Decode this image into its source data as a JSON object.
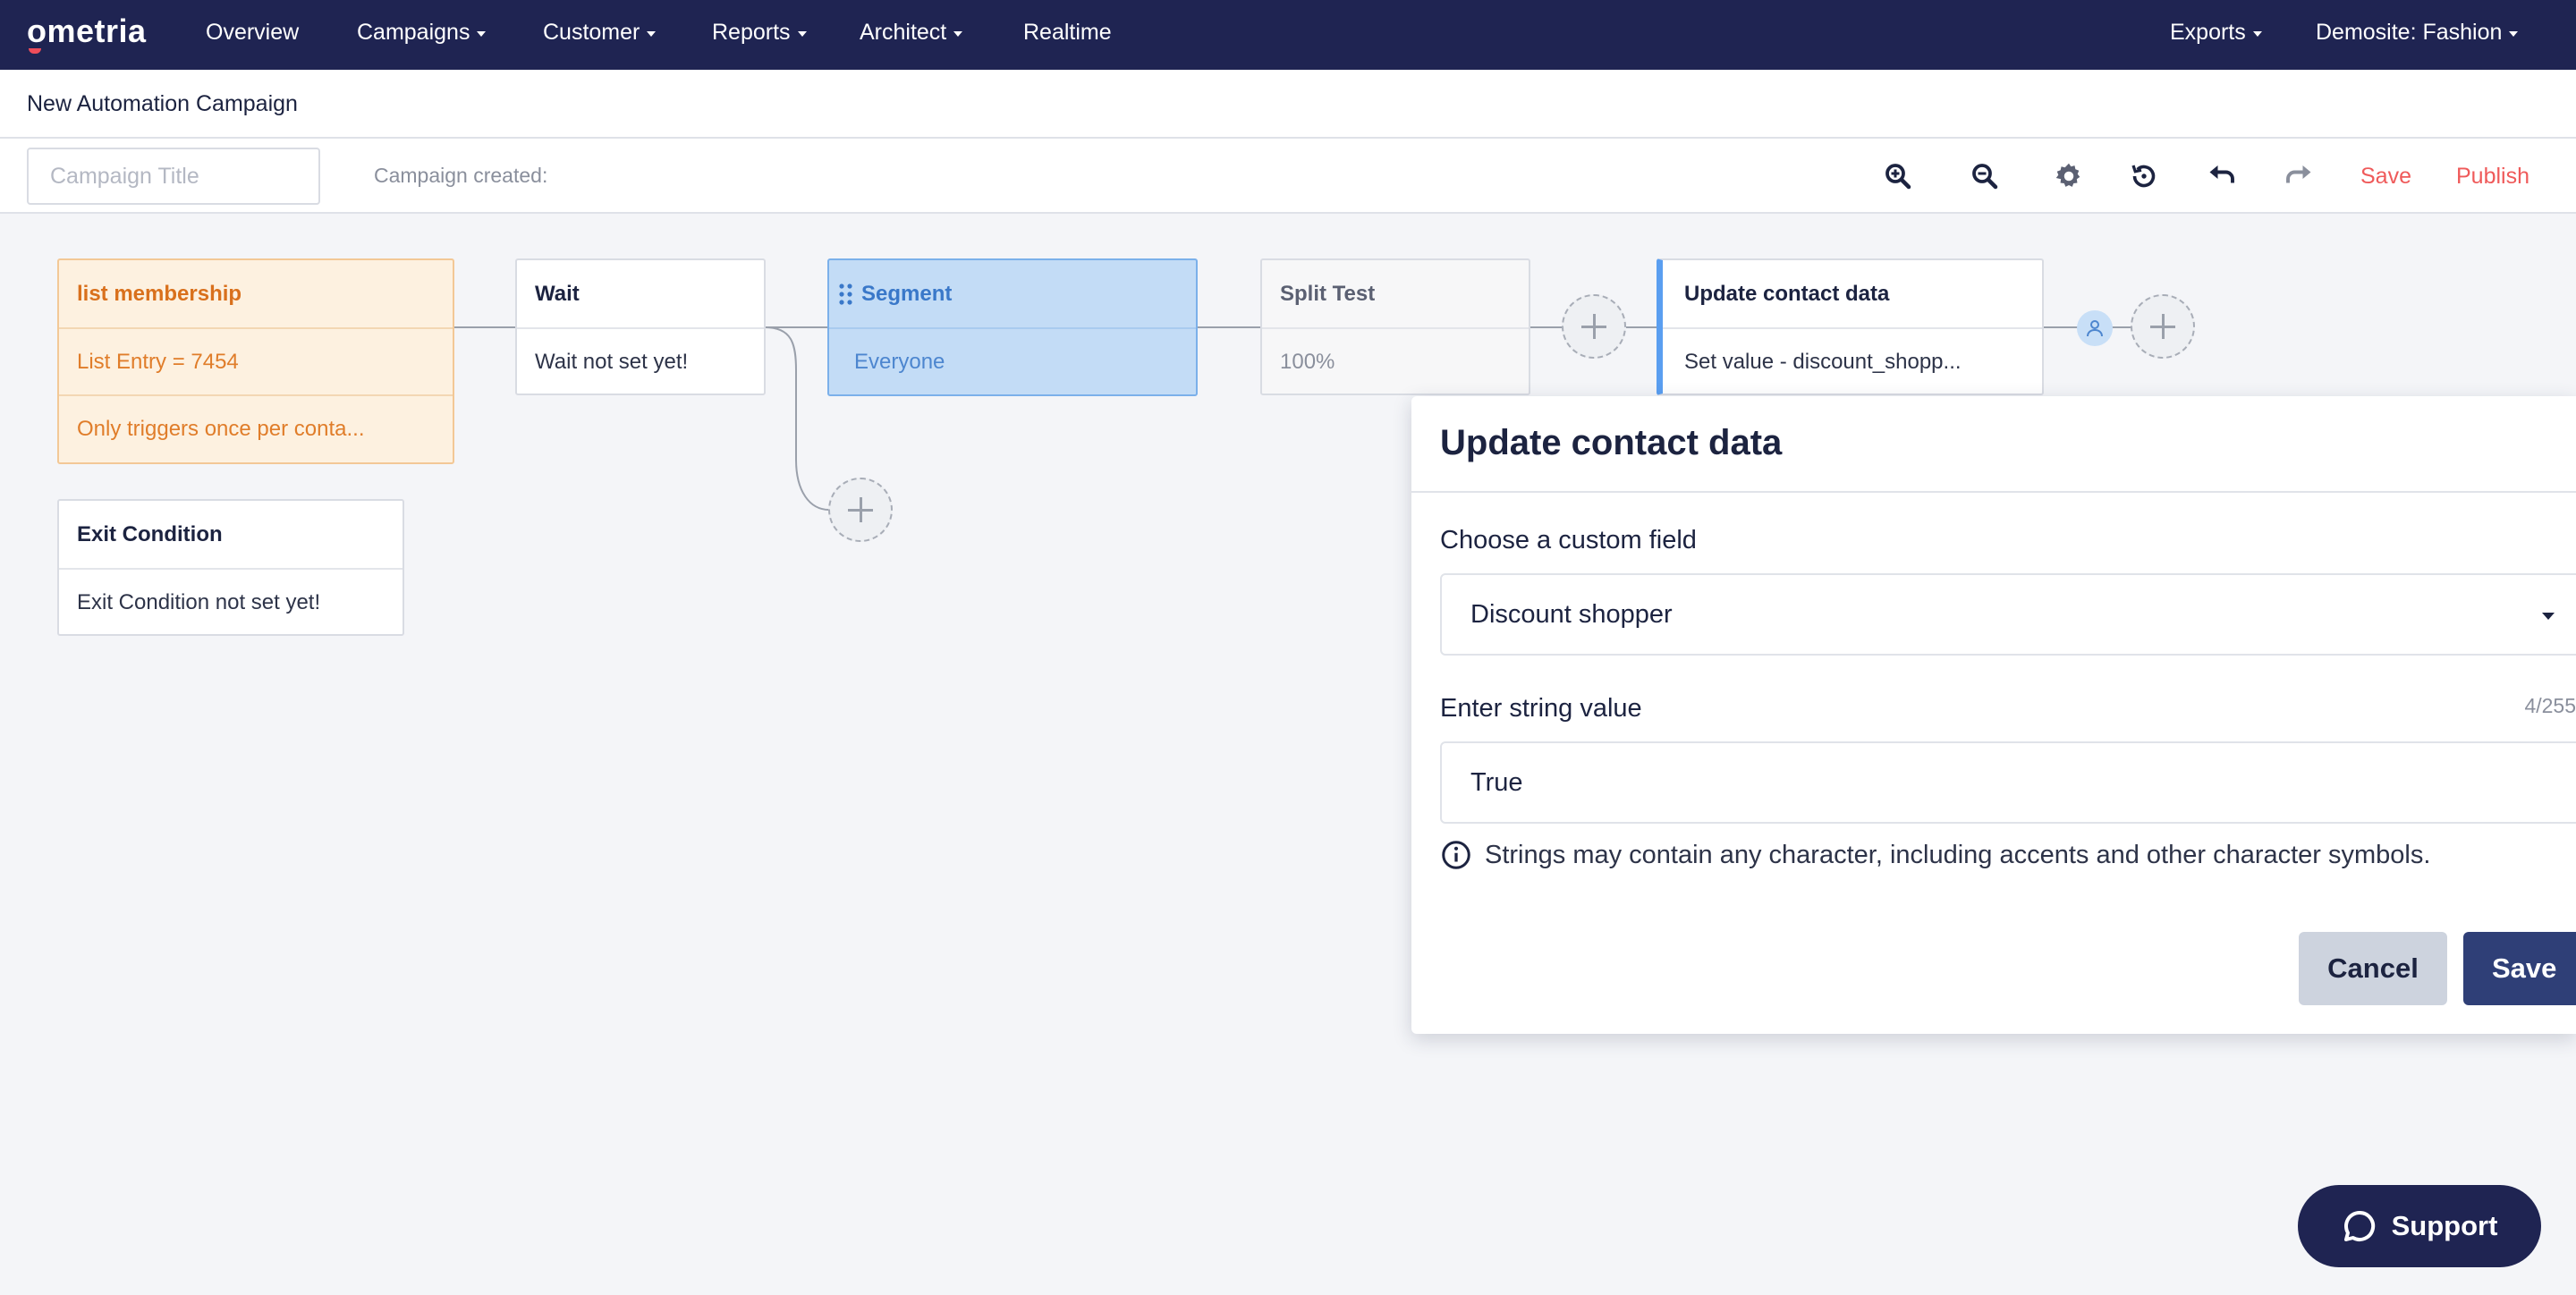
{
  "nav": {
    "logo": "ometria",
    "items": [
      "Overview",
      "Campaigns",
      "Customer",
      "Reports",
      "Architect",
      "Realtime"
    ],
    "exports": "Exports",
    "account": "Demosite: Fashion"
  },
  "titlebar": {
    "title": "New Automation Campaign"
  },
  "toolbar": {
    "title_placeholder": "Campaign Title",
    "created_label": "Campaign created:",
    "tools": [
      "zoom-in-icon",
      "zoom-out-icon",
      "gear-icon",
      "history-icon",
      "undo-icon",
      "redo-icon"
    ],
    "save_label": "Save",
    "publish_label": "Publish"
  },
  "canvas": {
    "trigger": {
      "title": "list membership",
      "line1": "List Entry = 7454",
      "line2": "Only triggers once per conta..."
    },
    "exit": {
      "title": "Exit Condition",
      "body": "Exit Condition not set yet!"
    },
    "wait": {
      "title": "Wait",
      "body": "Wait not set yet!"
    },
    "segment": {
      "title": "Segment",
      "body": "Everyone"
    },
    "split": {
      "title": "Split Test",
      "body": "100%"
    },
    "update": {
      "title": "Update contact data",
      "body": "Set value - discount_shopp..."
    }
  },
  "panel": {
    "title": "Update contact data",
    "field_label": "Choose a custom field",
    "field_value": "Discount shopper",
    "string_label": "Enter string value",
    "counter": "4/255",
    "string_value": "True",
    "hint": "Strings may contain any character, including accents and other character symbols.",
    "cancel_label": "Cancel",
    "save_label": "Save"
  },
  "support": {
    "label": "Support"
  },
  "colors": {
    "nav_bg": "#1f2452",
    "accent_red": "#ef5a5a",
    "segment_bg": "#c3dcf6",
    "trigger_bg": "#fdf1e0",
    "primary_button": "#2f3f77"
  }
}
